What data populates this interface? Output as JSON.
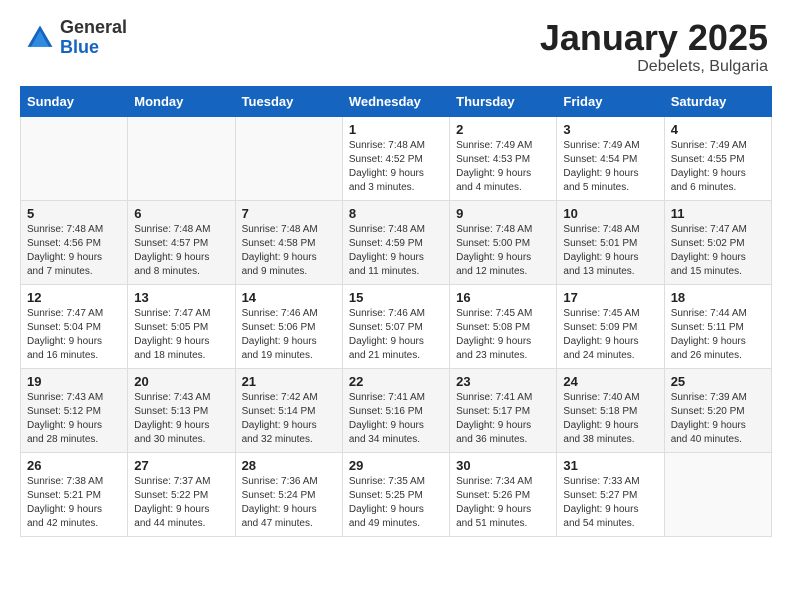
{
  "header": {
    "logo_general": "General",
    "logo_blue": "Blue",
    "title": "January 2025",
    "subtitle": "Debelets, Bulgaria"
  },
  "weekdays": [
    "Sunday",
    "Monday",
    "Tuesday",
    "Wednesday",
    "Thursday",
    "Friday",
    "Saturday"
  ],
  "weeks": [
    [
      {
        "day": "",
        "sunrise": "",
        "sunset": "",
        "daylight": ""
      },
      {
        "day": "",
        "sunrise": "",
        "sunset": "",
        "daylight": ""
      },
      {
        "day": "",
        "sunrise": "",
        "sunset": "",
        "daylight": ""
      },
      {
        "day": "1",
        "sunrise": "Sunrise: 7:48 AM",
        "sunset": "Sunset: 4:52 PM",
        "daylight": "Daylight: 9 hours and 3 minutes."
      },
      {
        "day": "2",
        "sunrise": "Sunrise: 7:49 AM",
        "sunset": "Sunset: 4:53 PM",
        "daylight": "Daylight: 9 hours and 4 minutes."
      },
      {
        "day": "3",
        "sunrise": "Sunrise: 7:49 AM",
        "sunset": "Sunset: 4:54 PM",
        "daylight": "Daylight: 9 hours and 5 minutes."
      },
      {
        "day": "4",
        "sunrise": "Sunrise: 7:49 AM",
        "sunset": "Sunset: 4:55 PM",
        "daylight": "Daylight: 9 hours and 6 minutes."
      }
    ],
    [
      {
        "day": "5",
        "sunrise": "Sunrise: 7:48 AM",
        "sunset": "Sunset: 4:56 PM",
        "daylight": "Daylight: 9 hours and 7 minutes."
      },
      {
        "day": "6",
        "sunrise": "Sunrise: 7:48 AM",
        "sunset": "Sunset: 4:57 PM",
        "daylight": "Daylight: 9 hours and 8 minutes."
      },
      {
        "day": "7",
        "sunrise": "Sunrise: 7:48 AM",
        "sunset": "Sunset: 4:58 PM",
        "daylight": "Daylight: 9 hours and 9 minutes."
      },
      {
        "day": "8",
        "sunrise": "Sunrise: 7:48 AM",
        "sunset": "Sunset: 4:59 PM",
        "daylight": "Daylight: 9 hours and 11 minutes."
      },
      {
        "day": "9",
        "sunrise": "Sunrise: 7:48 AM",
        "sunset": "Sunset: 5:00 PM",
        "daylight": "Daylight: 9 hours and 12 minutes."
      },
      {
        "day": "10",
        "sunrise": "Sunrise: 7:48 AM",
        "sunset": "Sunset: 5:01 PM",
        "daylight": "Daylight: 9 hours and 13 minutes."
      },
      {
        "day": "11",
        "sunrise": "Sunrise: 7:47 AM",
        "sunset": "Sunset: 5:02 PM",
        "daylight": "Daylight: 9 hours and 15 minutes."
      }
    ],
    [
      {
        "day": "12",
        "sunrise": "Sunrise: 7:47 AM",
        "sunset": "Sunset: 5:04 PM",
        "daylight": "Daylight: 9 hours and 16 minutes."
      },
      {
        "day": "13",
        "sunrise": "Sunrise: 7:47 AM",
        "sunset": "Sunset: 5:05 PM",
        "daylight": "Daylight: 9 hours and 18 minutes."
      },
      {
        "day": "14",
        "sunrise": "Sunrise: 7:46 AM",
        "sunset": "Sunset: 5:06 PM",
        "daylight": "Daylight: 9 hours and 19 minutes."
      },
      {
        "day": "15",
        "sunrise": "Sunrise: 7:46 AM",
        "sunset": "Sunset: 5:07 PM",
        "daylight": "Daylight: 9 hours and 21 minutes."
      },
      {
        "day": "16",
        "sunrise": "Sunrise: 7:45 AM",
        "sunset": "Sunset: 5:08 PM",
        "daylight": "Daylight: 9 hours and 23 minutes."
      },
      {
        "day": "17",
        "sunrise": "Sunrise: 7:45 AM",
        "sunset": "Sunset: 5:09 PM",
        "daylight": "Daylight: 9 hours and 24 minutes."
      },
      {
        "day": "18",
        "sunrise": "Sunrise: 7:44 AM",
        "sunset": "Sunset: 5:11 PM",
        "daylight": "Daylight: 9 hours and 26 minutes."
      }
    ],
    [
      {
        "day": "19",
        "sunrise": "Sunrise: 7:43 AM",
        "sunset": "Sunset: 5:12 PM",
        "daylight": "Daylight: 9 hours and 28 minutes."
      },
      {
        "day": "20",
        "sunrise": "Sunrise: 7:43 AM",
        "sunset": "Sunset: 5:13 PM",
        "daylight": "Daylight: 9 hours and 30 minutes."
      },
      {
        "day": "21",
        "sunrise": "Sunrise: 7:42 AM",
        "sunset": "Sunset: 5:14 PM",
        "daylight": "Daylight: 9 hours and 32 minutes."
      },
      {
        "day": "22",
        "sunrise": "Sunrise: 7:41 AM",
        "sunset": "Sunset: 5:16 PM",
        "daylight": "Daylight: 9 hours and 34 minutes."
      },
      {
        "day": "23",
        "sunrise": "Sunrise: 7:41 AM",
        "sunset": "Sunset: 5:17 PM",
        "daylight": "Daylight: 9 hours and 36 minutes."
      },
      {
        "day": "24",
        "sunrise": "Sunrise: 7:40 AM",
        "sunset": "Sunset: 5:18 PM",
        "daylight": "Daylight: 9 hours and 38 minutes."
      },
      {
        "day": "25",
        "sunrise": "Sunrise: 7:39 AM",
        "sunset": "Sunset: 5:20 PM",
        "daylight": "Daylight: 9 hours and 40 minutes."
      }
    ],
    [
      {
        "day": "26",
        "sunrise": "Sunrise: 7:38 AM",
        "sunset": "Sunset: 5:21 PM",
        "daylight": "Daylight: 9 hours and 42 minutes."
      },
      {
        "day": "27",
        "sunrise": "Sunrise: 7:37 AM",
        "sunset": "Sunset: 5:22 PM",
        "daylight": "Daylight: 9 hours and 44 minutes."
      },
      {
        "day": "28",
        "sunrise": "Sunrise: 7:36 AM",
        "sunset": "Sunset: 5:24 PM",
        "daylight": "Daylight: 9 hours and 47 minutes."
      },
      {
        "day": "29",
        "sunrise": "Sunrise: 7:35 AM",
        "sunset": "Sunset: 5:25 PM",
        "daylight": "Daylight: 9 hours and 49 minutes."
      },
      {
        "day": "30",
        "sunrise": "Sunrise: 7:34 AM",
        "sunset": "Sunset: 5:26 PM",
        "daylight": "Daylight: 9 hours and 51 minutes."
      },
      {
        "day": "31",
        "sunrise": "Sunrise: 7:33 AM",
        "sunset": "Sunset: 5:27 PM",
        "daylight": "Daylight: 9 hours and 54 minutes."
      },
      {
        "day": "",
        "sunrise": "",
        "sunset": "",
        "daylight": ""
      }
    ]
  ]
}
